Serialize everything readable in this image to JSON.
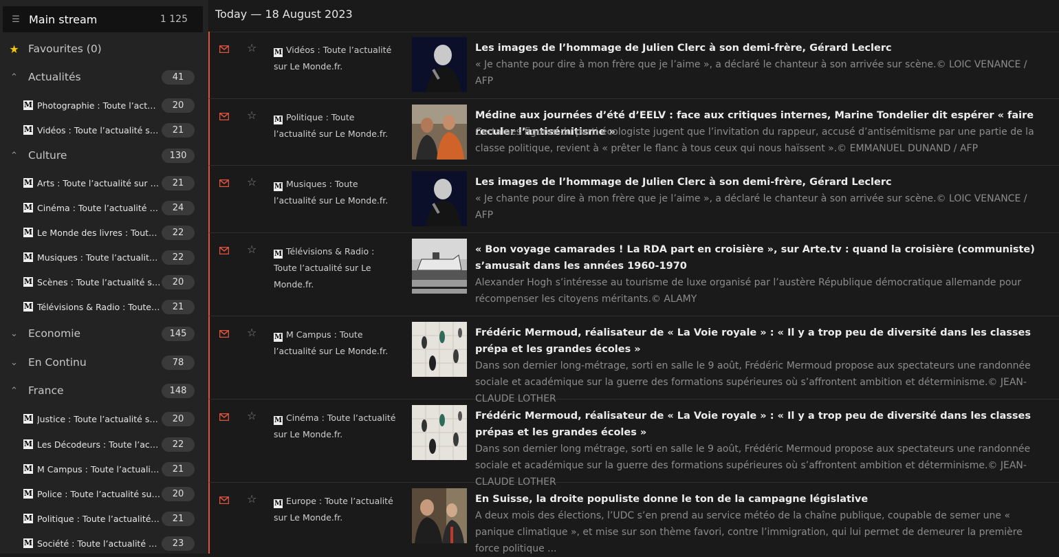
{
  "sidebar": {
    "main_stream": {
      "label": "Main stream",
      "count": "1 125"
    },
    "favourites": {
      "label": "Favourites (0)"
    },
    "categories": {
      "actualites": {
        "label": "Actualités",
        "count": "41"
      },
      "culture": {
        "label": "Culture",
        "count": "130"
      },
      "economie": {
        "label": "Economie",
        "count": "145"
      },
      "encontinu": {
        "label": "En Continu",
        "count": "78"
      },
      "france": {
        "label": "France",
        "count": "148"
      }
    },
    "feeds": [
      {
        "label": "Photographie : Toute l’actualité sur Le Monde.fr.",
        "count": "20"
      },
      {
        "label": "Vidéos : Toute l’actualité sur Le Monde.fr.",
        "count": "21"
      },
      {
        "label": "Arts : Toute l’actualité sur Le Monde.fr.",
        "count": "21"
      },
      {
        "label": "Cinéma : Toute l’actualité sur Le Monde.fr.",
        "count": "24"
      },
      {
        "label": "Le Monde des livres : Toute l’actualité sur Le Monde.fr.",
        "count": "22"
      },
      {
        "label": "Musiques : Toute l’actualité sur Le Monde.fr.",
        "count": "22"
      },
      {
        "label": "Scènes : Toute l’actualité sur Le Monde.fr.",
        "count": "20"
      },
      {
        "label": "Télévisions & Radio : Toute l’actualité sur Le Monde.fr.",
        "count": "21"
      },
      {
        "label": "Justice : Toute l’actualité sur Le Monde.fr.",
        "count": "20"
      },
      {
        "label": "Les Décodeurs : Toute l’actualité sur Le Monde.fr.",
        "count": "22"
      },
      {
        "label": "M Campus : Toute l’actualité sur Le Monde.fr.",
        "count": "21"
      },
      {
        "label": "Police : Toute l’actualité sur Le Monde.fr.",
        "count": "20"
      },
      {
        "label": "Politique : Toute l’actualité sur Le Monde.fr.",
        "count": "21"
      },
      {
        "label": "Société : Toute l’actualité sur Le Monde.fr.",
        "count": "23"
      }
    ]
  },
  "main": {
    "day_header": "Today — 18 August 2023",
    "articles": [
      {
        "source": "Vidéos : Toute l’actualité sur Le Monde.fr.",
        "title": "Les images de l’hommage de Julien Clerc à son demi-frère, Gérard Leclerc",
        "description": "« Je chante pour dire à mon frère que je l’aime », a déclaré le chanteur à son arrivée sur scène.© LOIC VENANCE / AFP"
      },
      {
        "source": "Politique : Toute l’actualité sur Le Monde.fr.",
        "title": "Médine aux journées d’été d’EELV : face aux critiques internes, Marine Tondelier dit espérer « faire reculer l’antisémitisme »",
        "description": "Certaines figures du parti écologiste jugent que l’invitation du rappeur, accusé d’antisémitisme par une partie de la classe politique, revient à « prêter le flanc à tous ceux qui nous haïssent ».© EMMANUEL DUNAND / AFP"
      },
      {
        "source": "Musiques : Toute l’actualité sur Le Monde.fr.",
        "title": "Les images de l’hommage de Julien Clerc à son demi-frère, Gérard Leclerc",
        "description": "« Je chante pour dire à mon frère que je l’aime », a déclaré le chanteur à son arrivée sur scène.© LOIC VENANCE / AFP"
      },
      {
        "source": "Télévisions & Radio : Toute l’actualité sur Le Monde.fr.",
        "title": "« Bon voyage camarades ! La RDA part en croisière », sur Arte.tv : quand la croisière (communiste) s’amusait dans les années 1960-1970",
        "description": "Alexander Hogh s’intéresse au tourisme de luxe organisé par l’austère République démocratique allemande pour récompenser les citoyens méritants.© ALAMY"
      },
      {
        "source": "M Campus : Toute l’actualité sur Le Monde.fr.",
        "title": "Frédéric Mermoud, réalisateur de « La Voie royale » : « Il y a trop peu de diversité dans les classes prépa et les grandes écoles »",
        "description": "Dans son dernier long-métrage, sorti en salle le 9 août, Frédéric Mermoud propose aux spectateurs une randonnée sociale et académique sur la guerre des formations supérieures où s’affrontent ambition et déterminisme.© JEAN-CLAUDE LOTHER"
      },
      {
        "source": "Cinéma : Toute l’actualité sur Le Monde.fr.",
        "title": "Frédéric Mermoud, réalisateur de « La Voie royale » : « Il y a trop peu de diversité dans les classes prépas et les grandes écoles »",
        "description": "Dans son dernier long métrage, sorti en salle le 9 août, Frédéric Mermoud propose aux spectateurs une randonnée sociale et académique sur la guerre des formations supérieures où s’affrontent ambition et déterminisme.© JEAN-CLAUDE LOTHER"
      },
      {
        "source": "Europe : Toute l’actualité sur Le Monde.fr.",
        "title": "En Suisse, la droite populiste donne le ton de la campagne législative",
        "description": "A deux mois des élections, l’UDC s’en prend au service météo de la chaîne publique, coupable de semer une « panique climatique », et mise sur son thème favori, contre l’immigration, qui lui permet de demeurer la première force politique ..."
      }
    ]
  },
  "colors": {
    "accent": "#e0523b",
    "favourite_star": "#f5c518"
  },
  "logo_glyph": "M"
}
